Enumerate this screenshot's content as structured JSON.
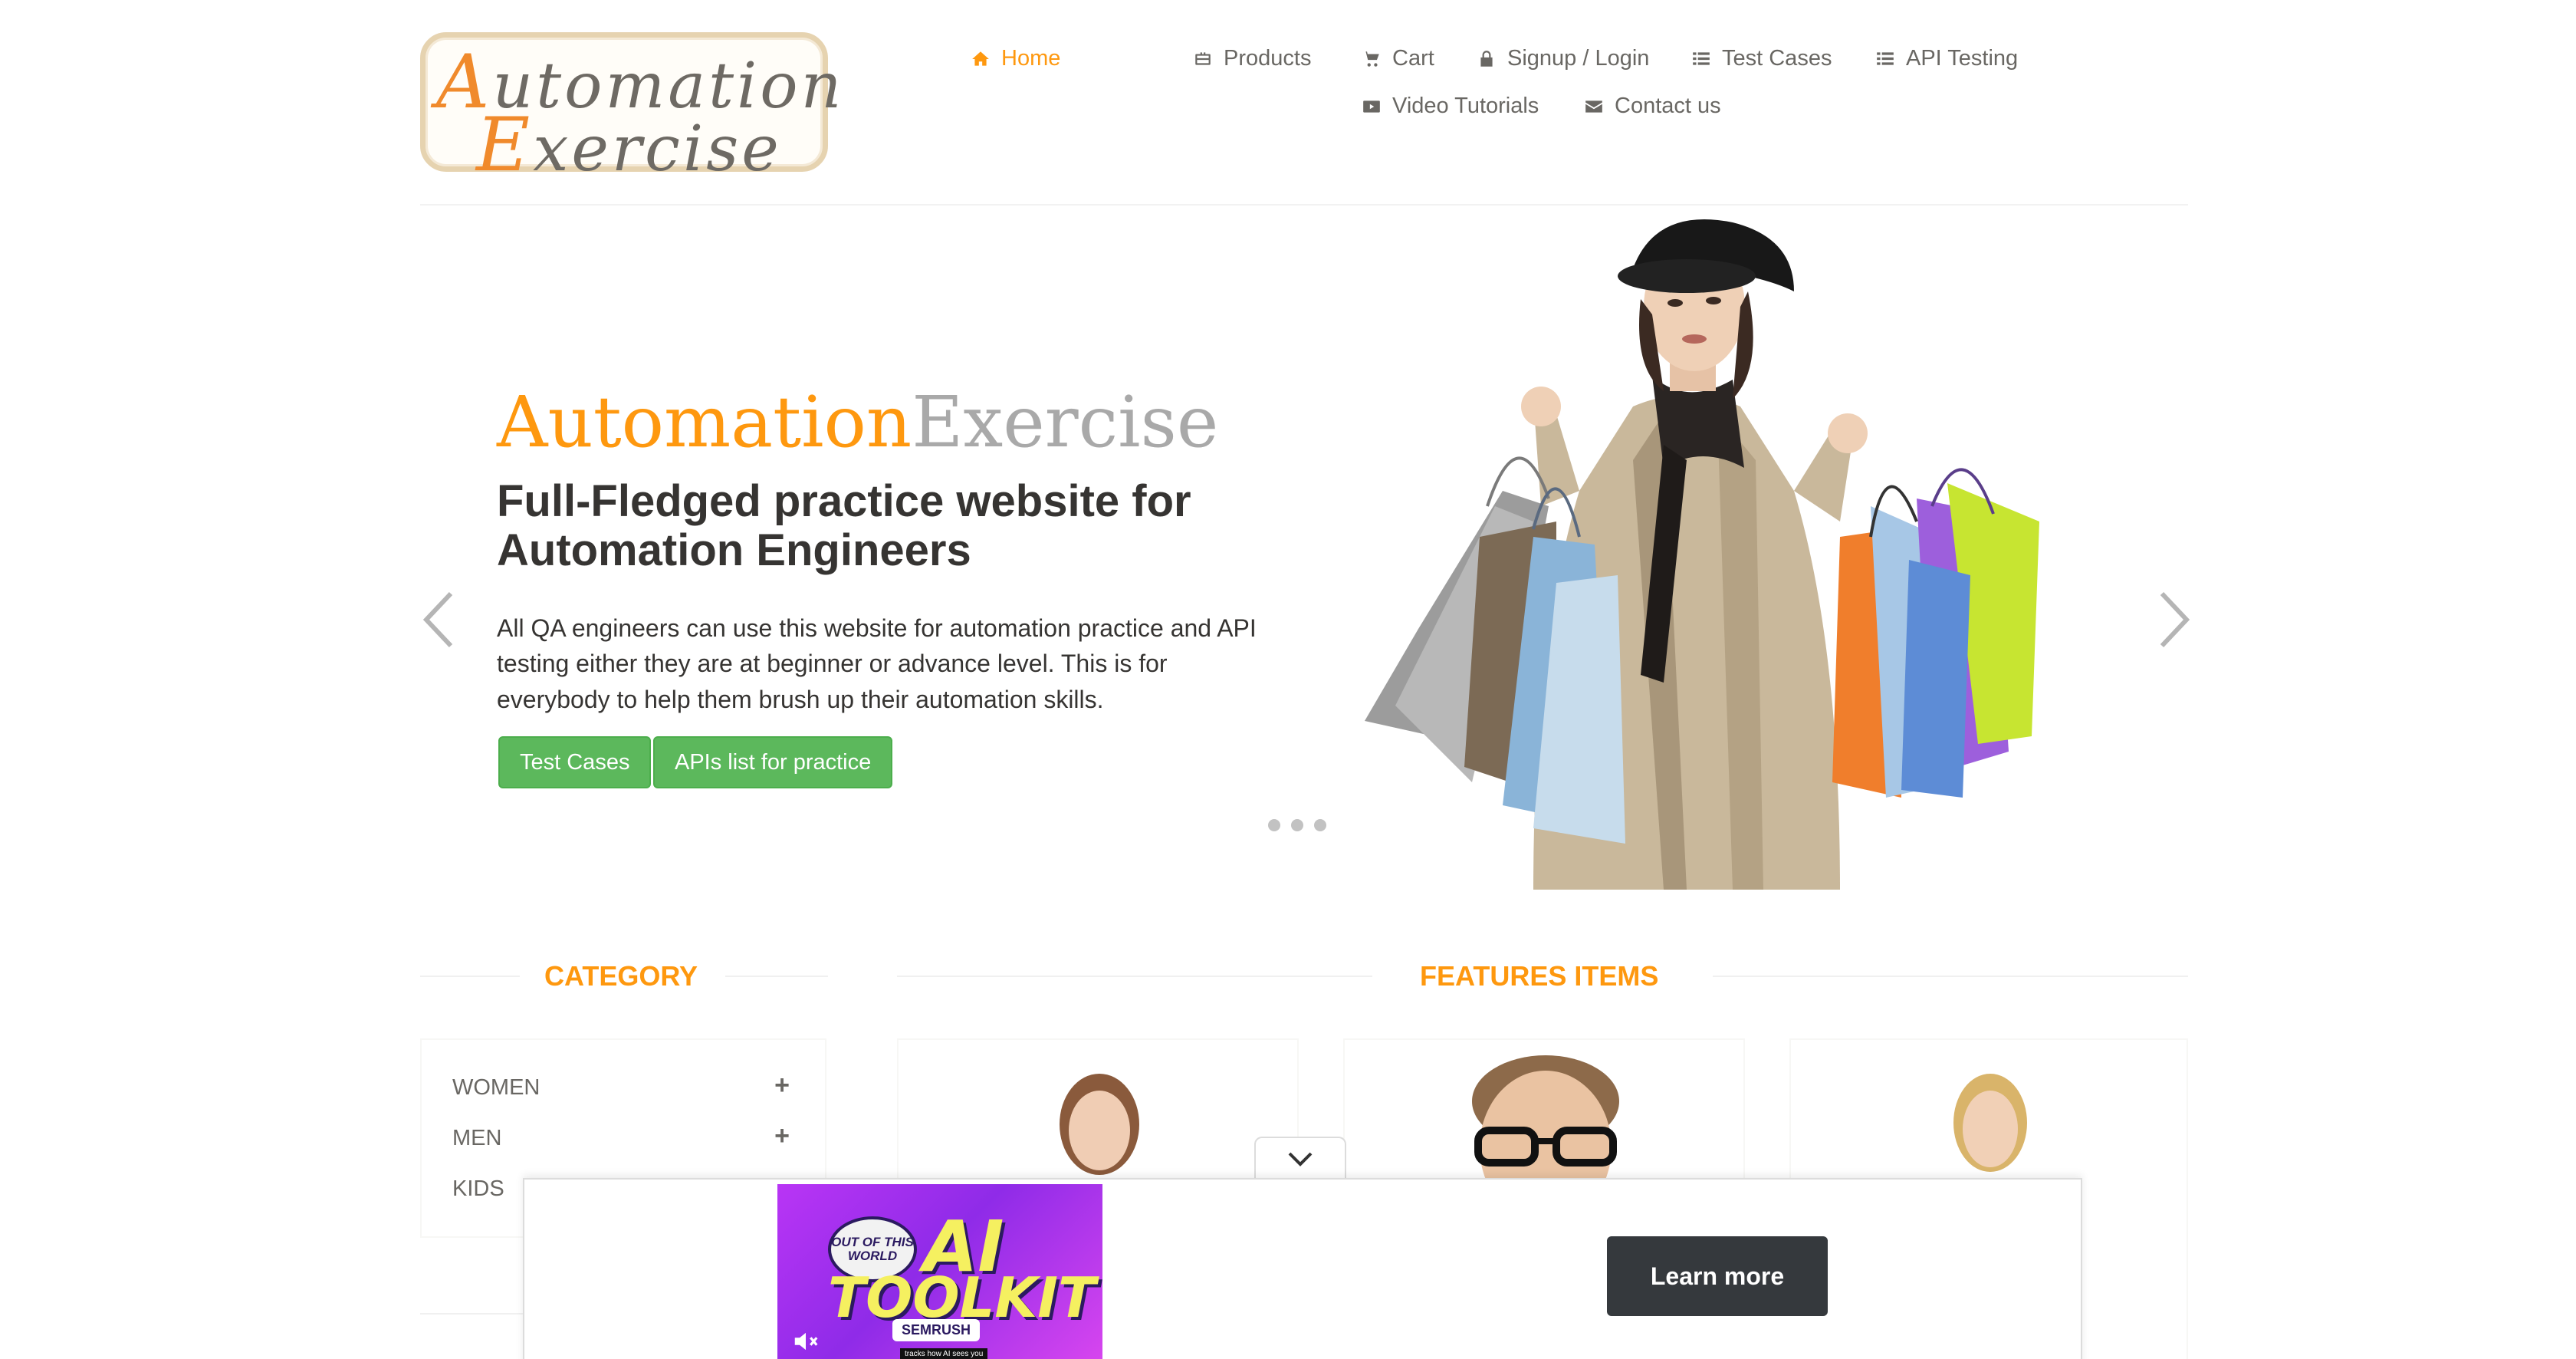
{
  "header": {
    "logo_text_line1": "Automation",
    "logo_text_line2": "Exercise",
    "nav_row1": [
      {
        "label": "Home",
        "icon": "home-icon",
        "active": true
      },
      {
        "label": "Products",
        "icon": "briefcase-icon"
      },
      {
        "label": "Cart",
        "icon": "cart-icon"
      },
      {
        "label": "Signup / Login",
        "icon": "lock-icon"
      },
      {
        "label": "Test Cases",
        "icon": "list-icon"
      },
      {
        "label": "API Testing",
        "icon": "list-icon"
      }
    ],
    "nav_row2": [
      {
        "label": "Video Tutorials",
        "icon": "youtube-play-icon"
      },
      {
        "label": "Contact us",
        "icon": "envelope-icon"
      }
    ]
  },
  "slider": {
    "brand_part1": "Automation",
    "brand_part2": "Exercise",
    "heading": "Full-Fledged practice website for Automation Engineers",
    "text": "All QA engineers can use this website for automation practice and API testing either they are at beginner or advance level. This is for everybody to help them brush up their automation skills.",
    "buttons": [
      "Test Cases",
      "APIs list for practice"
    ],
    "dot_count": 3
  },
  "sections": {
    "category_title": "CATEGORY",
    "features_title": "FEATURES ITEMS"
  },
  "category": {
    "items": [
      {
        "label": "WOMEN",
        "expand": "+"
      },
      {
        "label": "MEN",
        "expand": "+"
      },
      {
        "label": "KIDS",
        "expand": "+"
      }
    ]
  },
  "ad": {
    "badge": "OUT OF THIS WORLD",
    "line1": "AI",
    "line2": "TOOLKIT",
    "brand": "SEMRUSH",
    "tagline": "tracks how AI sees you",
    "button": "Learn more"
  },
  "colors": {
    "accent": "#fe980f",
    "button_green": "#5cb85c",
    "text": "#696763",
    "heading": "#363432",
    "ad_button": "#35393d"
  }
}
